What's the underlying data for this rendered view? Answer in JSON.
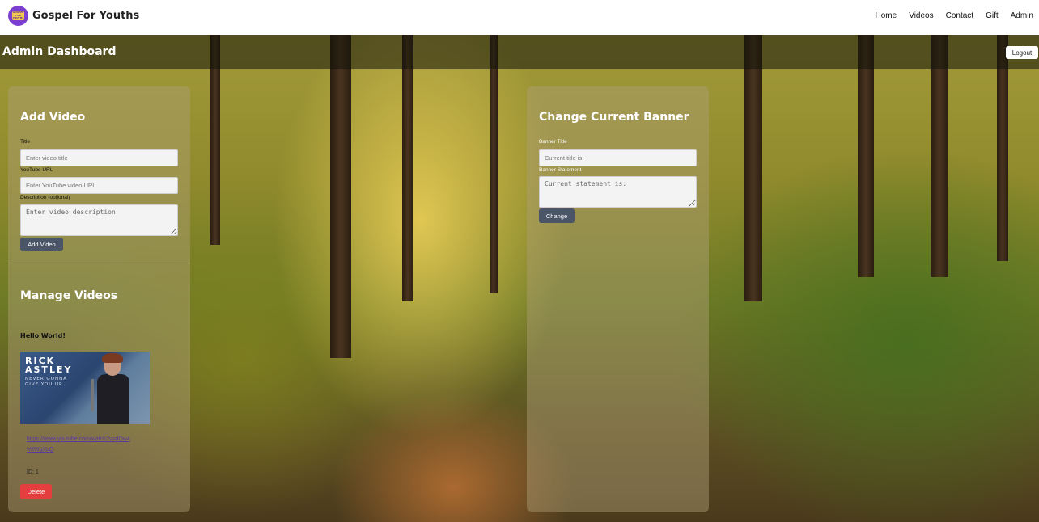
{
  "nav": {
    "brand": "Gospel For Youths",
    "logo_text": "GOSPEL FOR YOUTHS",
    "links": [
      "Home",
      "Videos",
      "Contact",
      "Gift",
      "Admin"
    ]
  },
  "header": {
    "title": "Admin Dashboard",
    "logout_label": "Logout"
  },
  "add_video": {
    "heading": "Add Video",
    "title_label": "Title",
    "title_placeholder": "Enter video title",
    "url_label": "YouTube URL",
    "url_placeholder": "Enter YouTube video URL",
    "description_label": "Description (optional)",
    "description_placeholder": "Enter video description",
    "submit_label": "Add Video"
  },
  "manage_videos": {
    "heading": "Manage Videos",
    "videos": [
      {
        "title": "Hello World!",
        "thumbnail": {
          "line1": "RICK",
          "line2": "ASTLEY",
          "line3": "NEVER GONNA GIVE YOU UP"
        },
        "url": "https://www.youtube.com/watch?v=dQw4w9WgXcQ",
        "id_text": "ID: 1",
        "delete_label": "Delete"
      }
    ]
  },
  "banner": {
    "heading": "Change Current Banner",
    "title_label": "Banner Title",
    "title_placeholder": "Current title is:",
    "statement_label": "Banner Statement",
    "statement_placeholder": "Current statement is:",
    "submit_label": "Change"
  },
  "colors": {
    "primary_button": "#4a5568",
    "danger_button": "#e53e3e",
    "logo_purple": "#7b3fd0",
    "logo_yellow": "#f2c94c"
  }
}
